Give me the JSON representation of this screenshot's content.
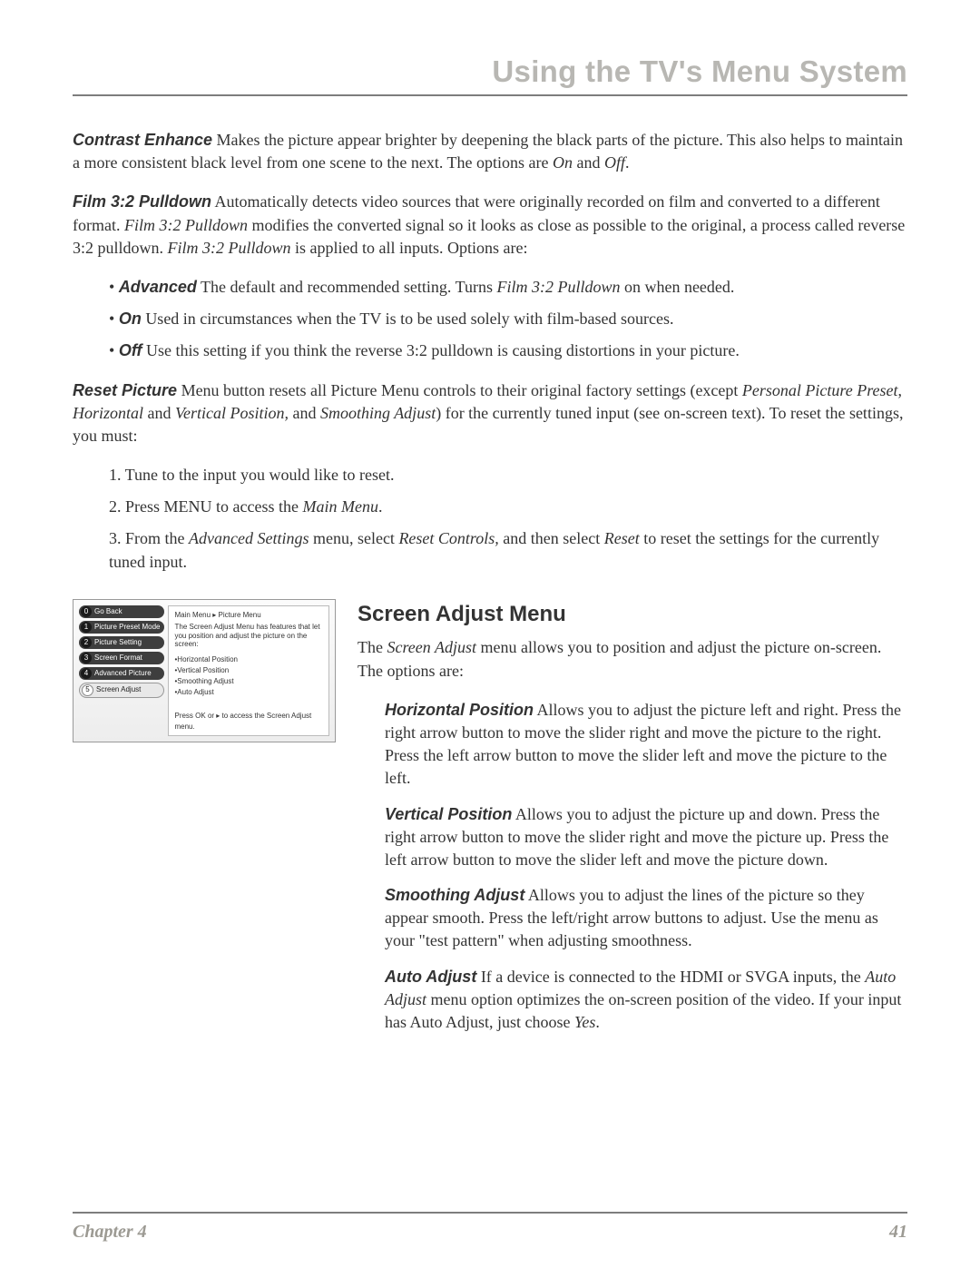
{
  "header": {
    "title": "Using the TV's Menu System"
  },
  "p1": {
    "label": "Contrast Enhance",
    "text": "   Makes the picture appear brighter by deepening the black parts of the picture. This also helps to maintain a more consistent black level from one scene to the next. The options are ",
    "opt_on": "On",
    "and": " and ",
    "opt_off": "Off",
    "period": "."
  },
  "p2": {
    "label": "Film 3:2 Pulldown",
    "t1": "   Automatically detects video sources that were originally recorded on film and converted to a different format. ",
    "i1": "Film 3:2 Pulldown",
    "t2": " modifies the converted signal so it looks as close as possible to the original, a process called reverse 3:2 pulldown. ",
    "i2": "Film 3:2 Pulldown",
    "t3": " is applied to all inputs. Options are:"
  },
  "opts": {
    "adv": {
      "label": "Advanced",
      "t1": "   The default and recommended setting. Turns ",
      "i1": "Film 3:2 Pulldown",
      "t2": " on when needed."
    },
    "on": {
      "label": "On",
      "t1": "   Used in circumstances when the TV is to be used solely with film-based sources."
    },
    "off": {
      "label": "Off",
      "t1": "   Use this setting if you think the reverse 3:2 pulldown is causing distortions in your picture."
    }
  },
  "reset": {
    "label": "Reset Picture",
    "t1": "   Menu button resets all Picture Menu controls to their original factory settings (except ",
    "i1": "Personal Picture Preset",
    "c1": ", ",
    "i2": "Horizontal",
    "c2": " and ",
    "i3": "Vertical Position,",
    "c3": " and ",
    "i4": "Smoothing Adjust",
    "t2": ") for the currently tuned input (see on-screen text). To reset the settings, you must:"
  },
  "steps": {
    "s1": "1. Tune to the input you would like to reset.",
    "s2a": "2. Press MENU to access the ",
    "s2b": "Main Menu",
    "s2c": ".",
    "s3a": "3. From the ",
    "s3b": "Advanced Settings",
    "s3c": " menu, select ",
    "s3d": "Reset Controls,",
    "s3e": " and then select ",
    "s3f": "Reset",
    "s3g": " to reset the settings for the currently tuned input."
  },
  "figure": {
    "crumb": "Main Menu ▸ Picture Menu",
    "desc": "The Screen Adjust Menu has features that let you position and adjust the picture on the screen:",
    "opts": [
      "•Horizontal Position",
      "•Vertical Position",
      "•Smoothing Adjust",
      "•Auto Adjust"
    ],
    "foot": "Press OK or ▸ to access the Screen Adjust menu.",
    "items": [
      {
        "n": "0",
        "label": "Go Back"
      },
      {
        "n": "1",
        "label": "Picture Preset Mode"
      },
      {
        "n": "2",
        "label": "Picture Setting"
      },
      {
        "n": "3",
        "label": "Screen Format"
      },
      {
        "n": "4",
        "label": "Advanced Picture"
      },
      {
        "n": "5",
        "label": "Screen Adjust"
      }
    ]
  },
  "screen_adjust": {
    "heading": "Screen Adjust Menu",
    "intro_a": "The ",
    "intro_b": "Screen Adjust",
    "intro_c": " menu allows you to position and adjust the picture on-screen. The options are:",
    "hp": {
      "label": "Horizontal Position",
      "t": "   Allows you to adjust the picture left and right. Press the right arrow button to move the slider right and move the picture to the right. Press the left arrow button to move the slider left and move the picture to the left."
    },
    "vp": {
      "label": "Vertical Position",
      "t": "   Allows you to adjust the picture up and down. Press the right arrow button to move the slider right and move the picture up. Press the left arrow button to move the slider left and move the picture down."
    },
    "sa": {
      "label": "Smoothing Adjust",
      "t": "   Allows you to adjust the lines of the picture so they appear smooth. Press the left/right arrow buttons to adjust. Use the menu as your \"test pattern\" when adjusting smoothness."
    },
    "aa": {
      "label": "Auto Adjust",
      "t1": "   If a device is connected to the HDMI or SVGA inputs, the ",
      "i1": "Auto Adjust",
      "t2": " menu option optimizes the on-screen position of the video. If your input has Auto Adjust, just choose ",
      "i2": "Yes",
      "t3": "."
    }
  },
  "footer": {
    "left": "Chapter 4",
    "right": "41"
  }
}
